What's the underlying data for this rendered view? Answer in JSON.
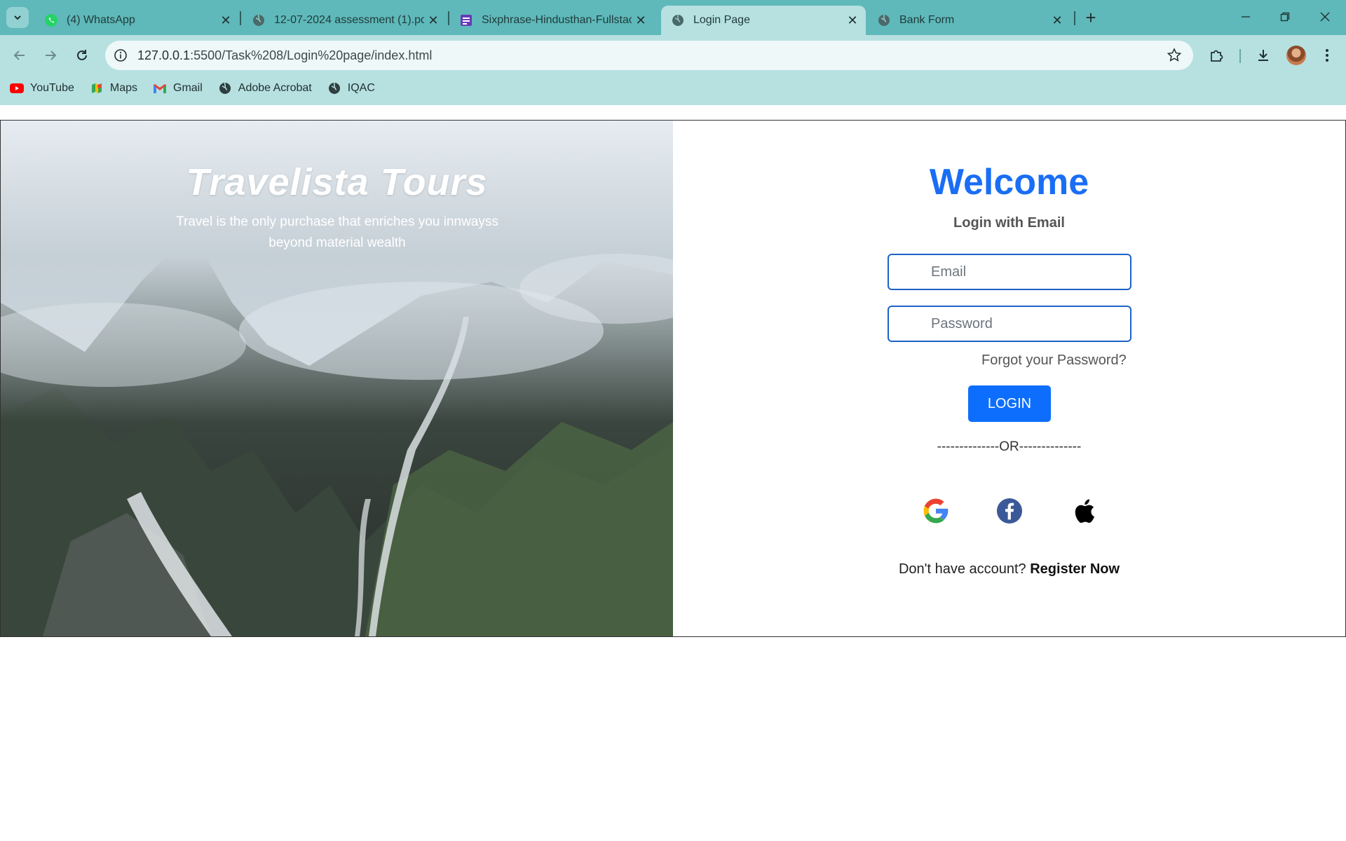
{
  "browser": {
    "tabs": [
      {
        "title": "(4) WhatsApp",
        "icon": "whatsapp-icon",
        "active": false
      },
      {
        "title": "12-07-2024 assessment (1).pdf",
        "icon": "globe-icon",
        "active": false
      },
      {
        "title": "Sixphrase-Hindusthan-Fullstack",
        "icon": "sheets-icon",
        "active": false
      },
      {
        "title": "Login Page",
        "icon": "globe-icon",
        "active": true
      },
      {
        "title": "Bank Form",
        "icon": "globe-icon",
        "active": false
      }
    ],
    "url_host": "127.0.0.1",
    "url_rest": ":5500/Task%208/Login%20page/index.html",
    "bookmarks": [
      {
        "label": "YouTube",
        "icon": "youtube-icon"
      },
      {
        "label": "Maps",
        "icon": "maps-icon"
      },
      {
        "label": "Gmail",
        "icon": "gmail-icon"
      },
      {
        "label": "Adobe Acrobat",
        "icon": "globe-icon"
      },
      {
        "label": "IQAC",
        "icon": "globe-icon"
      }
    ],
    "colors": {
      "tabstrip": "#5fb8b9",
      "toolbar": "#b7e0e1"
    }
  },
  "page": {
    "hero": {
      "title": "Travelista Tours",
      "subtitle": "Travel is the only purchase that enriches you innwayss beyond material wealth"
    },
    "form": {
      "welcome": "Welcome",
      "subtitle": "Login with Email",
      "email_placeholder": "Email",
      "password_placeholder": "Password",
      "forgot": "Forgot your Password?",
      "login_button": "LOGIN",
      "divider": "--------------OR--------------",
      "social": [
        "google-icon",
        "facebook-icon",
        "apple-icon"
      ],
      "register_prompt": "Don't have account?",
      "register_link": "Register Now"
    },
    "colors": {
      "accent": "#0d6efd",
      "welcome": "#1a6ef5",
      "input_border": "#1c62c7"
    }
  }
}
